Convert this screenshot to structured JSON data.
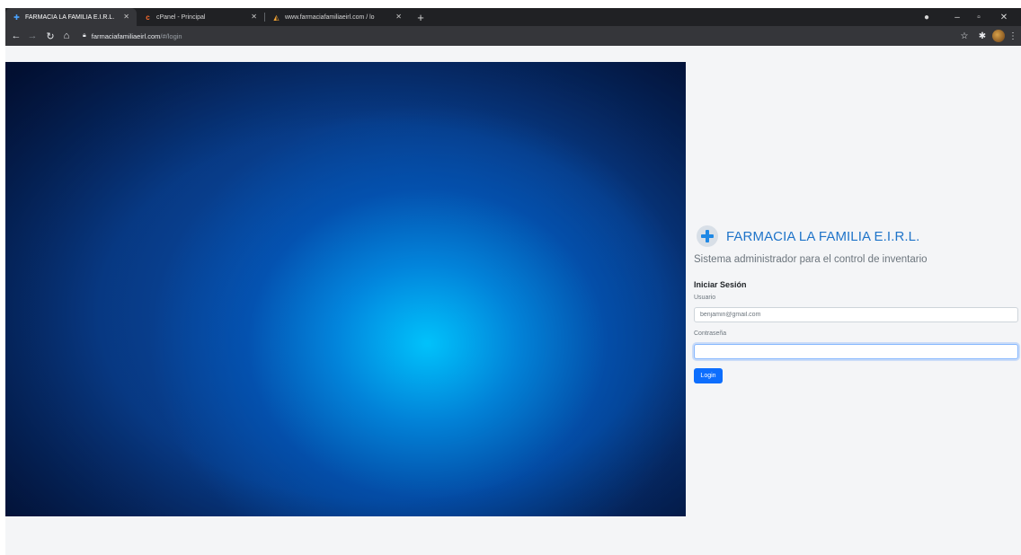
{
  "browser": {
    "tabs": [
      {
        "title": "FARMACIA LA FAMILIA E.I.R.L.",
        "active": true,
        "favicon": "plus-cross-icon"
      },
      {
        "title": "cPanel - Principal",
        "active": false,
        "favicon": "cpanel-icon"
      },
      {
        "title": "www.farmaciafamiliaeirl.com / lo",
        "active": false,
        "favicon": "phpmyadmin-icon"
      }
    ],
    "url": {
      "host": "farmaciafamiliaeirl.com",
      "path": "/#/login"
    }
  },
  "brand": {
    "title": "FARMACIA LA FAMILIA E.I.R.L.",
    "subtitle": "Sistema administrador para el control de inventario"
  },
  "login": {
    "heading": "Iniciar Sesión",
    "user_label": "Usuario",
    "user_value": "benjamin@gmail.com",
    "password_label": "Contraseña",
    "password_value": "",
    "button_label": "Login"
  },
  "colors": {
    "brand_blue": "#1f74c9",
    "button_blue": "#0d6efd",
    "chrome_dark": "#202124"
  }
}
